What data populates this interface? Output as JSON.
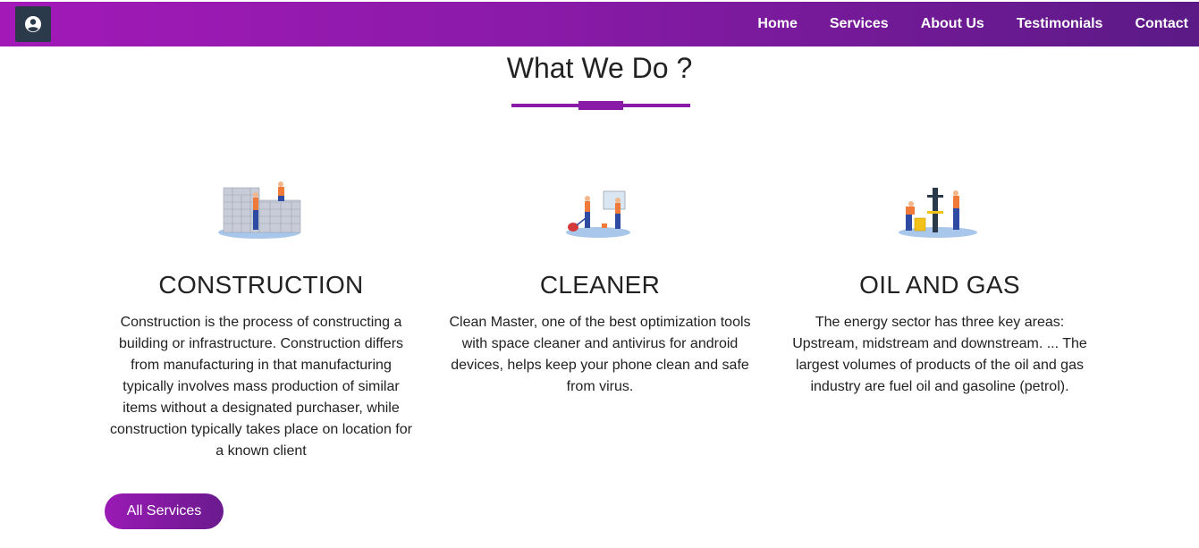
{
  "nav": {
    "items": [
      {
        "label": "Home"
      },
      {
        "label": "Services"
      },
      {
        "label": "About Us"
      },
      {
        "label": "Testimonials"
      },
      {
        "label": "Contact"
      }
    ]
  },
  "section": {
    "title": "What We Do ?"
  },
  "services": [
    {
      "title": "CONSTRUCTION",
      "description": "Construction is the process of constructing a building or infrastructure. Construction differs from manufacturing in that manufacturing typically involves mass production of similar items without a designated purchaser, while construction typically takes place on location for a known client",
      "icon": "construction-illustration"
    },
    {
      "title": "CLEANER",
      "description": "Clean Master, one of the best optimization tools with space cleaner and antivirus for android devices, helps keep your phone clean and safe from virus.",
      "icon": "cleaner-illustration"
    },
    {
      "title": "OIL AND GAS",
      "description": "The energy sector has three key areas: Upstream, midstream and downstream. ... The largest volumes of products of the oil and gas industry are fuel oil and gasoline (petrol).",
      "icon": "oil-gas-illustration"
    }
  ],
  "cta": {
    "label": "All Services"
  },
  "colors": {
    "brand_purple": "#8a1aa8",
    "nav_start": "#a219b8",
    "nav_end": "#5b1a86",
    "avatar_bg": "#2b3a4a"
  }
}
